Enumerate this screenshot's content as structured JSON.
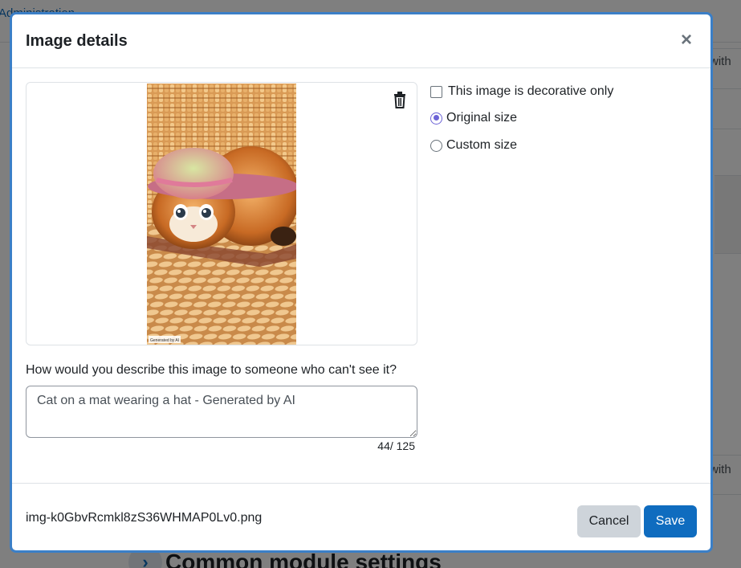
{
  "background": {
    "breadcrumb": "Administration",
    "side_text_1": "with",
    "side_text_2": "with",
    "section_title": "Common module settings"
  },
  "modal": {
    "title": "Image details",
    "close_icon": "close-icon",
    "delete_icon": "trash-icon",
    "image_badge": "Generated by AI",
    "options": {
      "decorative_label": "This image is decorative only",
      "decorative_checked": false,
      "original_size_label": "Original size",
      "original_size_checked": true,
      "custom_size_label": "Custom size",
      "custom_size_checked": false
    },
    "description_label": "How would you describe this image to someone who can't see it?",
    "alt_text": "Cat on a mat wearing a hat - Generated by AI",
    "char_count": "44/ 125",
    "filename": "img-k0GbvRcmkl8zS36WHMAP0Lv0.png",
    "cancel_label": "Cancel",
    "save_label": "Save"
  },
  "colors": {
    "primary": "#0f6cbf",
    "radio_accent": "#6c63d6",
    "modal_border": "#3b7fc7",
    "cancel_bg": "#ced4da"
  }
}
